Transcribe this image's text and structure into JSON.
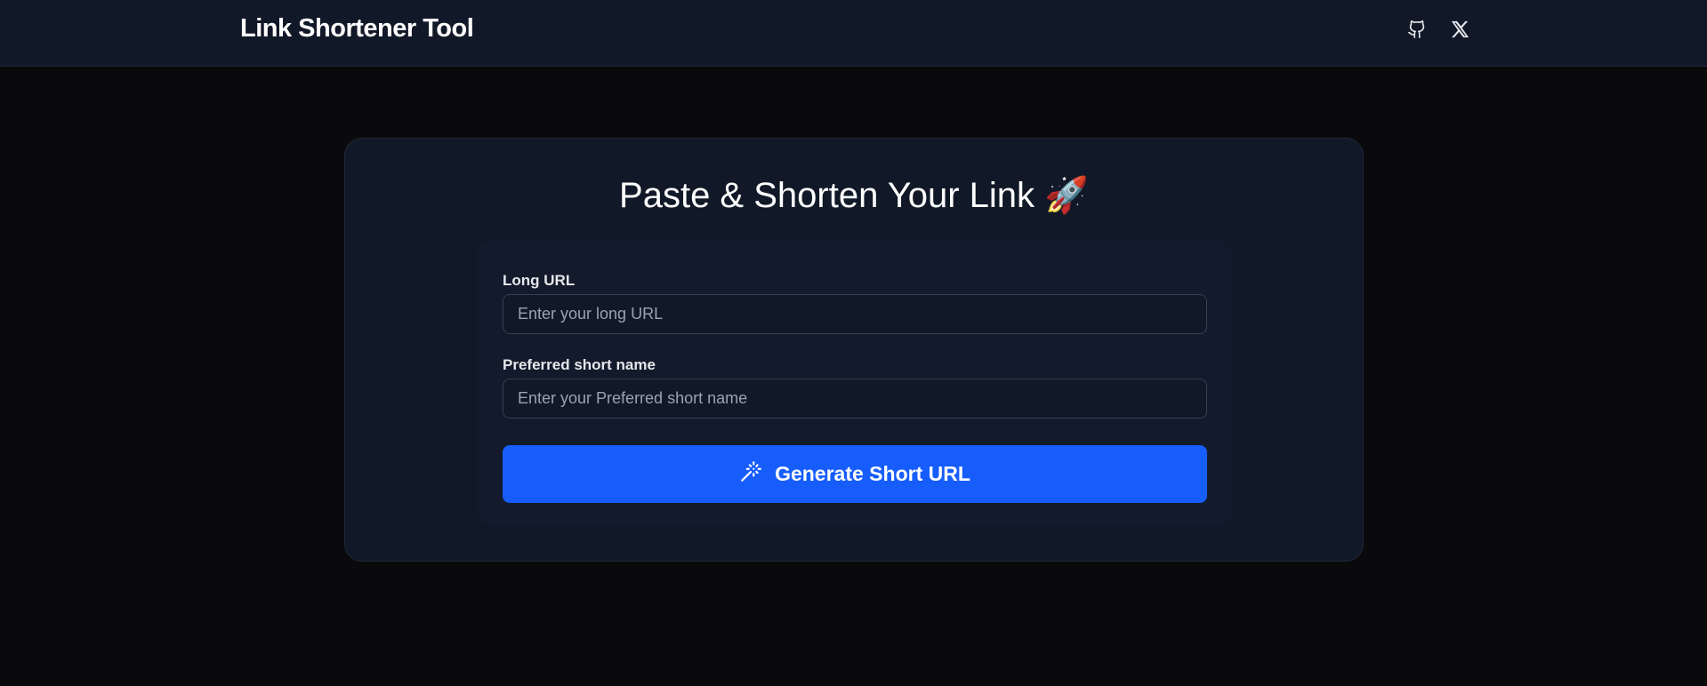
{
  "header": {
    "brand": "Link Shortener Tool",
    "icons": [
      "github-icon",
      "x-twitter-icon"
    ]
  },
  "card": {
    "title": "Paste & Shorten Your Link 🚀"
  },
  "form": {
    "long_url": {
      "label": "Long URL",
      "value": "",
      "placeholder": "Enter your long URL"
    },
    "short_name": {
      "label": "Preferred short name",
      "value": "",
      "placeholder": "Enter your Preferred short name"
    },
    "submit": {
      "label": "Generate Short URL",
      "icon": "magic-wand-icon"
    }
  },
  "colors": {
    "accent": "#165dfc",
    "background": "#0a0a0c",
    "surface": "#111827"
  }
}
